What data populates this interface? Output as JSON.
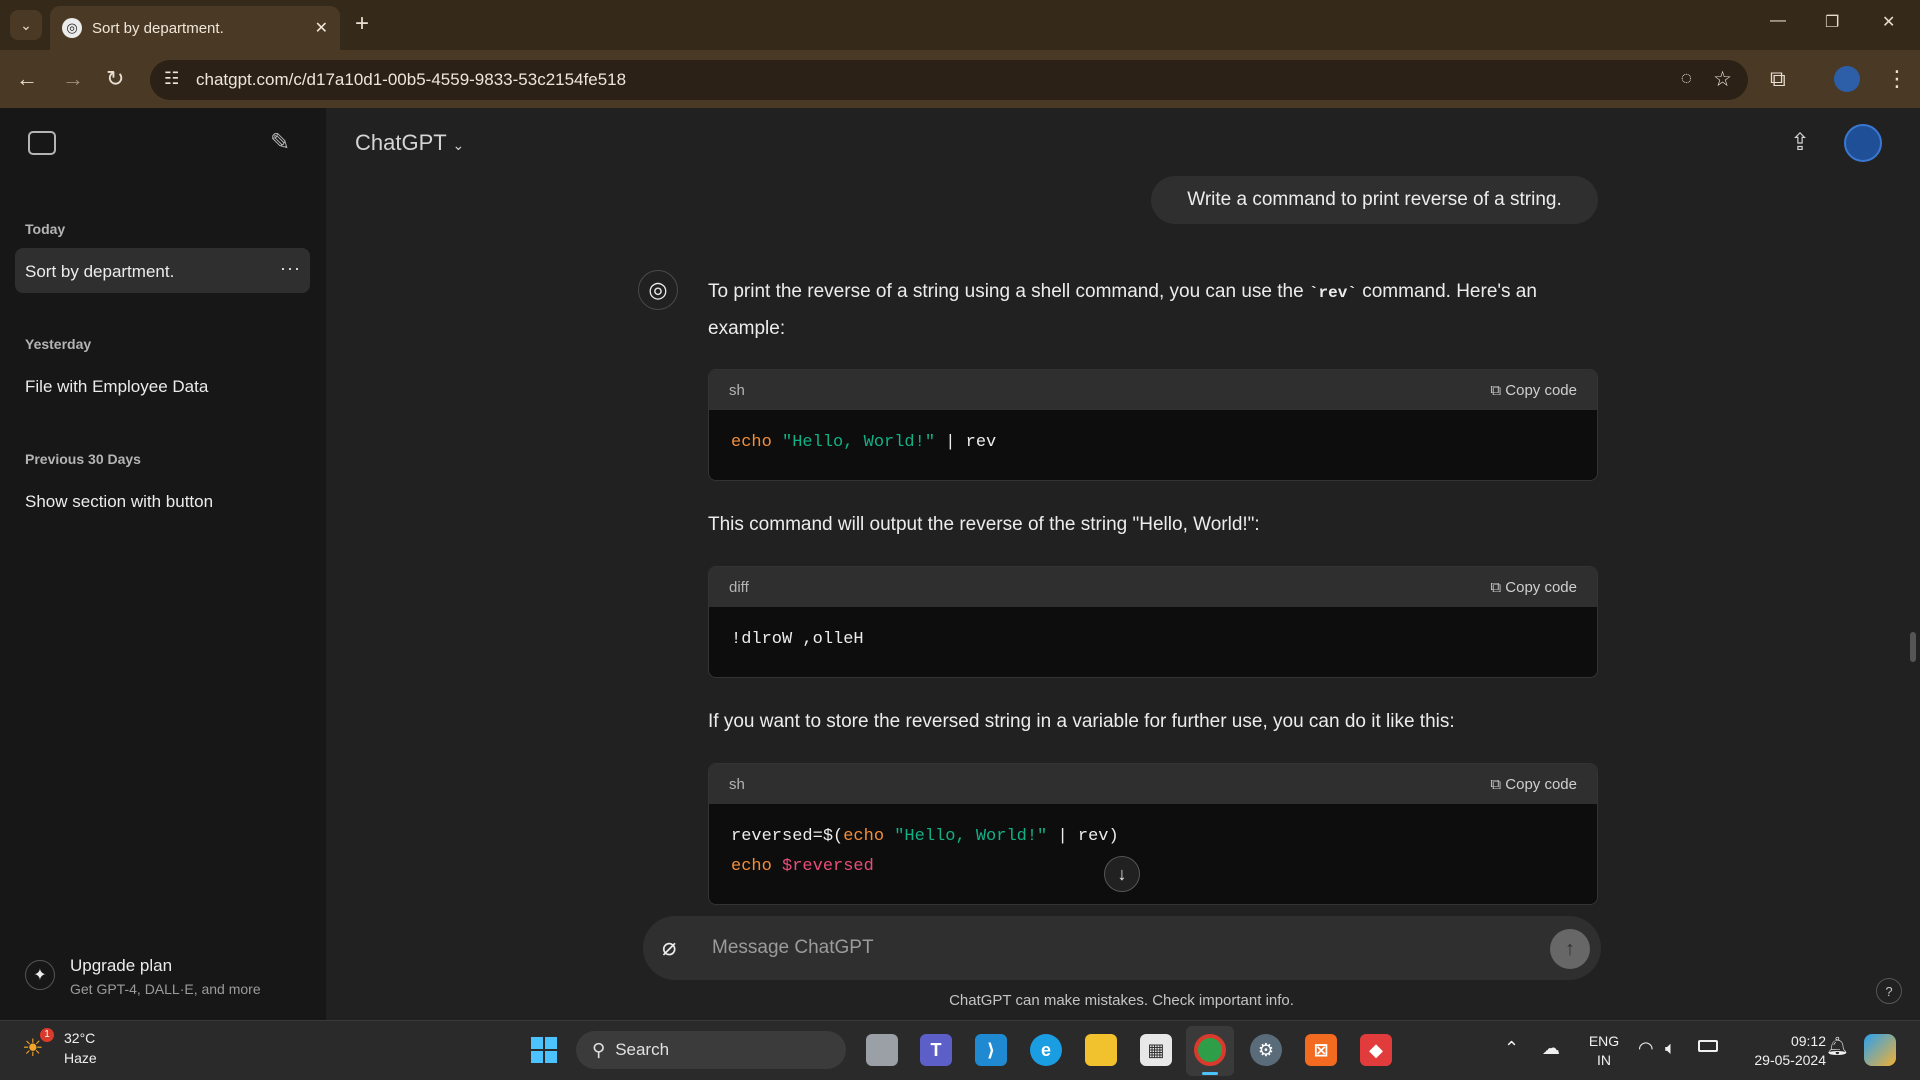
{
  "browser": {
    "tab_title": "Sort by department.",
    "url": "chatgpt.com/c/d17a10d1-00b5-4559-9833-53c2154fe518"
  },
  "sidebar": {
    "sections": [
      {
        "label": "Today",
        "items": [
          "Sort by department."
        ]
      },
      {
        "label": "Yesterday",
        "items": [
          "File with Employee Data"
        ]
      },
      {
        "label": "Previous 30 Days",
        "items": [
          "Show section with button"
        ]
      }
    ],
    "upgrade_title": "Upgrade plan",
    "upgrade_subtitle": "Get GPT-4, DALL·E, and more"
  },
  "header": {
    "model_name": "ChatGPT"
  },
  "chat": {
    "user_message": "Write a command to print reverse of a string.",
    "para1_pre": "To print the reverse of a string using a shell command, you can use the ",
    "para1_code": "`rev`",
    "para1_post": " command. Here's an example:",
    "code1_lang": "sh",
    "copy_label": "Copy code",
    "para2": "This command will output the reverse of the string \"Hello, World!\":",
    "code2_lang": "diff",
    "code2_text": "!dlroW ,olleH",
    "para3": "If you want to store the reversed string in a variable for further use, you can do it like this:",
    "code3_lang": "sh"
  },
  "code1": {
    "kw": "echo",
    "str": "\"Hello, World!\"",
    "rest": " | rev"
  },
  "code3": {
    "l1_a": "reversed=$(",
    "l1_kw": "echo",
    "l1_str": "\"Hello, World!\"",
    "l1_rest": " | rev)",
    "l2_kw": "echo",
    "l2_var": "$reversed"
  },
  "input": {
    "placeholder": "Message ChatGPT",
    "footer": "ChatGPT can make mistakes. Check important info."
  },
  "taskbar": {
    "weather_temp": "32°C",
    "weather_desc": "Haze",
    "weather_badge": "1",
    "search_label": "Search",
    "lang_1": "ENG",
    "lang_2": "IN",
    "time": "09:12",
    "date": "29-05-2024"
  }
}
